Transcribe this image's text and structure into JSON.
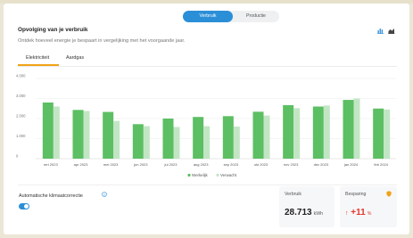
{
  "toggle": {
    "left": "Verbruik",
    "right": "Productie"
  },
  "header": {
    "title": "Opvolging van je verbruik",
    "subtitle": "Ontdek hoeveel energie je bespaart in vergelijking met het voorgaande jaar."
  },
  "tabs": [
    {
      "label": "Elektriciteit"
    },
    {
      "label": "Aardgas"
    }
  ],
  "chart_data": {
    "type": "bar",
    "categories": [
      "mrt 2023",
      "apr 2023",
      "mei 2023",
      "jun 2023",
      "jul 2023",
      "aug 2023",
      "sep 2023",
      "okt 2023",
      "nov 2023",
      "dec 2023",
      "jan 2024",
      "feb 2024"
    ],
    "yticks": [
      "4.000",
      "3.000",
      "2.000",
      "1.000",
      "0"
    ],
    "ylim": [
      0,
      4000
    ],
    "series": [
      {
        "name": "Werkelijk",
        "color": "#5cbf63",
        "values": [
          2800,
          2430,
          2330,
          1720,
          2000,
          2080,
          2120,
          2340,
          2670,
          2600,
          2930,
          2500
        ]
      },
      {
        "name": "Verwacht",
        "color": "#c2e6c4",
        "values": [
          2600,
          2380,
          1880,
          1620,
          1580,
          1620,
          1600,
          2150,
          2520,
          2650,
          3000,
          2450
        ]
      }
    ],
    "grid": true,
    "legend": "bottom-center"
  },
  "climate": {
    "label": "Automatische klimaatcorrectie",
    "enabled": true
  },
  "kpis": {
    "verbruik": {
      "label": "Verbruik",
      "value": "28.713",
      "unit": "kWh"
    },
    "besparing": {
      "label": "Besparing",
      "arrow": "↑",
      "value": "+11",
      "unit": "%"
    }
  },
  "colors": {
    "accent": "#2b8fd8",
    "tab_underline": "#f0a315",
    "negative": "#e2362f"
  }
}
